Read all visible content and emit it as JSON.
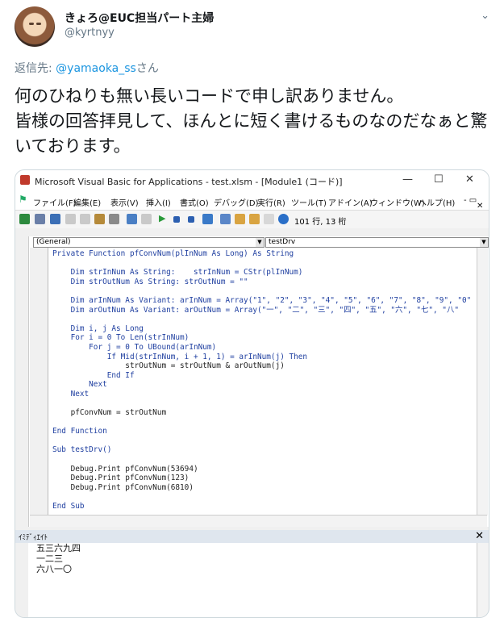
{
  "tweet": {
    "display_name": "きょろ@EUC担当パート主婦",
    "handle": "@kyrtnyy",
    "reply_prefix": "返信先: ",
    "reply_to": "@yamaoka_ss",
    "reply_suffix": "さん",
    "text": "何のひねりも無い長いコードで申し訳ありません。\n皆様の回答拝見して、ほんとに短く書けるものなのだなぁと驚いております。"
  },
  "vba": {
    "window_title": "Microsoft Visual Basic for Applications - test.xlsm - [Module1 (コード)]",
    "menu": [
      "ファイル(F)",
      "編集(E)",
      "表示(V)",
      "挿入(I)",
      "書式(O)",
      "デバッグ(D)",
      "実行(R)",
      "ツール(T)",
      "アドイン(A)",
      "ウィンドウ(W)",
      "ヘルプ(H)"
    ],
    "status_position": "101 行, 13 桁",
    "combo_left": "(General)",
    "combo_right": "testDrv",
    "code_lines": [
      "Private Function pfConvNum(plInNum As Long) As String",
      "",
      "    Dim strInNum As String:    strInNum = CStr(plInNum)",
      "    Dim strOutNum As String: strOutNum = \"\"",
      "",
      "    Dim arInNum As Variant: arInNum = Array(\"1\", \"2\", \"3\", \"4\", \"5\", \"6\", \"7\", \"8\", \"9\", \"0\"",
      "    Dim arOutNum As Variant: arOutNum = Array(\"一\", \"二\", \"三\", \"四\", \"五\", \"六\", \"七\", \"八\"",
      "",
      "    Dim i, j As Long",
      "    For i = 0 To Len(strInNum)",
      "        For j = 0 To UBound(arInNum)",
      "            If Mid(strInNum, i + 1, 1) = arInNum(j) Then",
      "                strOutNum = strOutNum & arOutNum(j)",
      "            End If",
      "        Next",
      "    Next",
      "",
      "    pfConvNum = strOutNum",
      "",
      "End Function",
      "",
      "Sub testDrv()",
      "",
      "    Debug.Print pfConvNum(53694)",
      "    Debug.Print pfConvNum(123)",
      "    Debug.Print pfConvNum(6810)",
      "",
      "End Sub"
    ],
    "immediate_title": "ｲﾐﾃﾞｨｴｲﾄ",
    "immediate_lines": [
      "五三六九四",
      "一二三",
      "六八一〇"
    ]
  }
}
